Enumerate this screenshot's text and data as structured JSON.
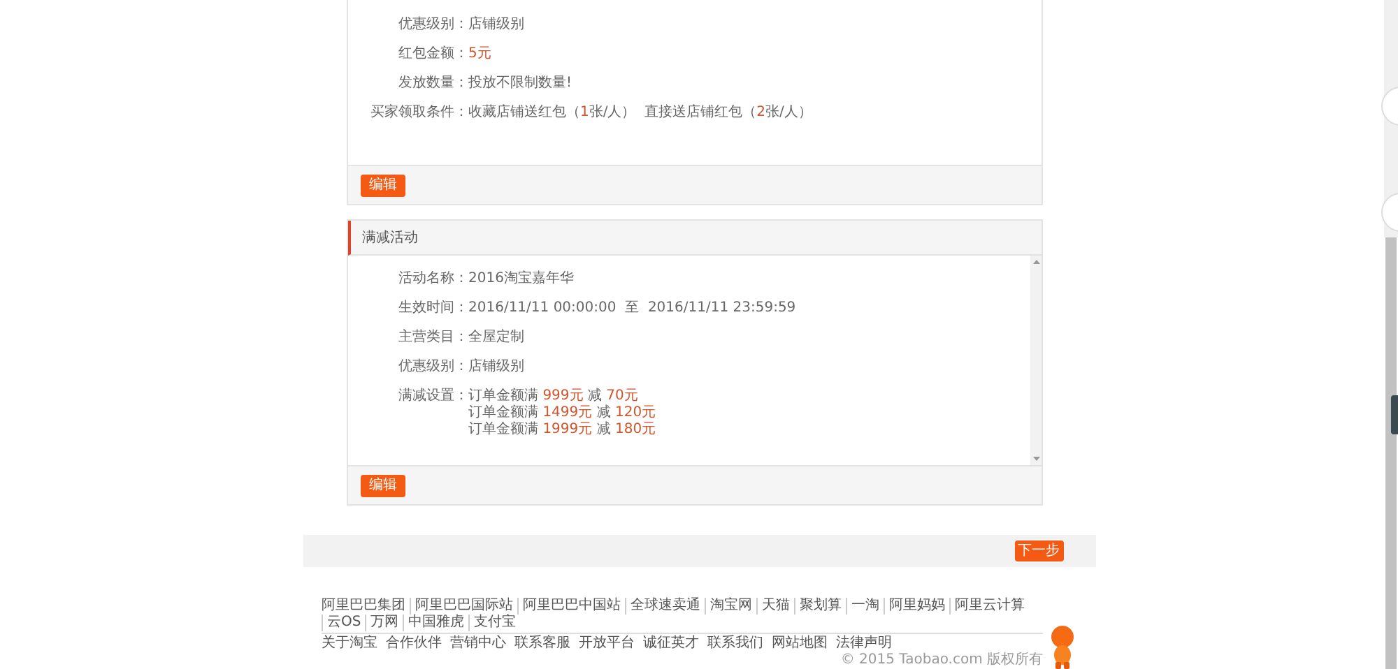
{
  "coupon_card": {
    "rows": [
      {
        "label": "优惠级别：",
        "lines": [
          [
            {
              "text": "店铺级别",
              "highlight": false
            }
          ]
        ]
      },
      {
        "label": "红包金额：",
        "lines": [
          [
            {
              "text": "5元",
              "highlight": true
            }
          ]
        ]
      },
      {
        "label": "发放数量：",
        "lines": [
          [
            {
              "text": "投放不限制数量!",
              "highlight": false
            }
          ]
        ]
      },
      {
        "label": "买家领取条件：",
        "lines": [
          [
            {
              "text": "收藏店铺送红包（",
              "highlight": false
            },
            {
              "text": "1",
              "highlight": true
            },
            {
              "text": "张/人）  直接送店铺红包（",
              "highlight": false
            },
            {
              "text": "2",
              "highlight": true
            },
            {
              "text": "张/人）",
              "highlight": false
            }
          ]
        ]
      }
    ],
    "edit_button": "编辑"
  },
  "discount_card": {
    "title": "满减活动",
    "rows": [
      {
        "label": "活动名称：",
        "lines": [
          [
            {
              "text": "2016淘宝嘉年华",
              "highlight": false
            }
          ]
        ]
      },
      {
        "label": "生效时间：",
        "lines": [
          [
            {
              "text": "2016/11/11 00:00:00  至  2016/11/11 23:59:59",
              "highlight": false
            }
          ]
        ]
      },
      {
        "label": "主营类目：",
        "lines": [
          [
            {
              "text": "全屋定制",
              "highlight": false
            }
          ]
        ]
      },
      {
        "label": "优惠级别：",
        "lines": [
          [
            {
              "text": "店铺级别",
              "highlight": false
            }
          ]
        ]
      },
      {
        "label": "满减设置：",
        "lines": [
          [
            {
              "text": "订单金额满 ",
              "highlight": false
            },
            {
              "text": "999元",
              "highlight": true
            },
            {
              "text": " 减 ",
              "highlight": false
            },
            {
              "text": "70元",
              "highlight": true
            }
          ],
          [
            {
              "text": "订单金额满 ",
              "highlight": false
            },
            {
              "text": "1499元",
              "highlight": true
            },
            {
              "text": " 减 ",
              "highlight": false
            },
            {
              "text": "120元",
              "highlight": true
            }
          ],
          [
            {
              "text": "订单金额满 ",
              "highlight": false
            },
            {
              "text": "1999元",
              "highlight": true
            },
            {
              "text": " 减 ",
              "highlight": false
            },
            {
              "text": "180元",
              "highlight": true
            }
          ]
        ]
      }
    ],
    "edit_button": "编辑"
  },
  "next_button": "下一步",
  "footer": {
    "links": [
      "阿里巴巴集团",
      "阿里巴巴国际站",
      "阿里巴巴中国站",
      "全球速卖通",
      "淘宝网",
      "天猫",
      "聚划算",
      "一淘",
      "阿里妈妈",
      "阿里云计算",
      "云OS",
      "万网",
      "中国雅虎",
      "支付宝"
    ],
    "links_2": [
      "关于淘宝",
      "合作伙伴",
      "营销中心",
      "联系客服",
      "开放平台",
      "诚征英才",
      "联系我们",
      "网站地图",
      "法律声明"
    ],
    "copyright": "© 2015 Taobao.com 版权所有"
  }
}
